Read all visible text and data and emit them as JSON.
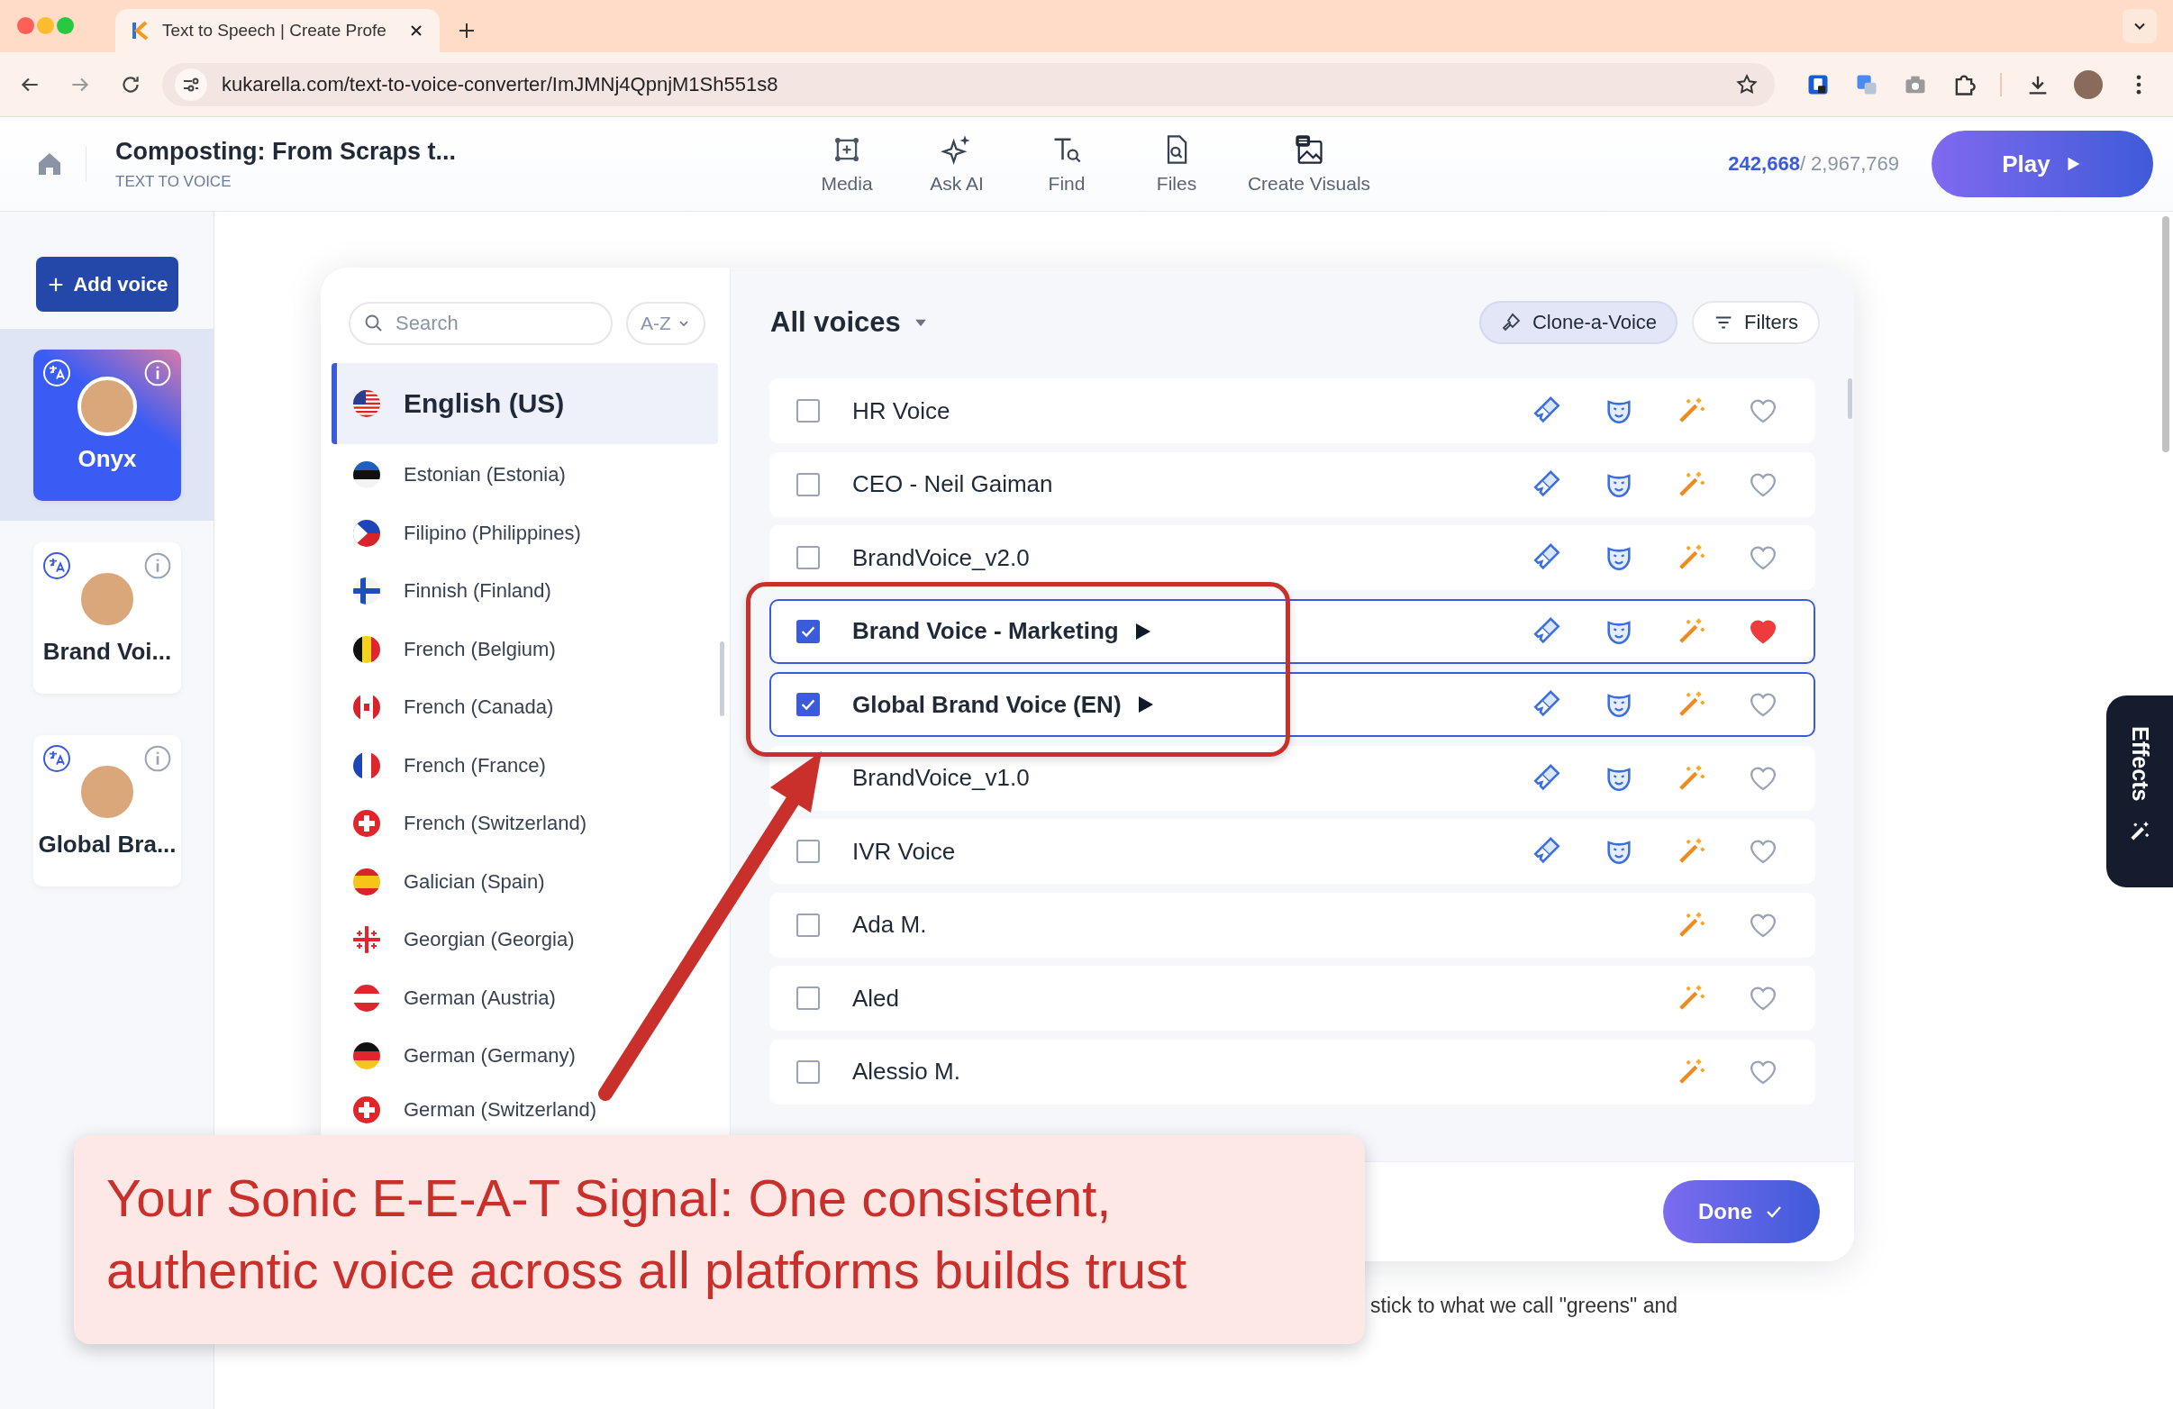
{
  "browser": {
    "tab_title": "Text to Speech | Create Profe",
    "url": "kukarella.com/text-to-voice-converter/ImJMNj4QpnjM1Sh551s8"
  },
  "header": {
    "title": "Composting: From Scraps t...",
    "subtitle": "TEXT TO VOICE",
    "tools": [
      {
        "label": "Media",
        "kind": "media"
      },
      {
        "label": "Ask AI",
        "kind": "ai"
      },
      {
        "label": "Find",
        "kind": "find"
      },
      {
        "label": "Files",
        "kind": "files"
      },
      {
        "label": "Create Visuals",
        "kind": "visuals"
      }
    ],
    "count_used": "242,668",
    "count_total": "/ 2,967,769",
    "play": "Play"
  },
  "sidebar": {
    "add_voice": "Add voice",
    "voices": [
      {
        "name": "Onyx",
        "selected": true
      },
      {
        "name": "Brand Voi...",
        "selected": false
      },
      {
        "name": "Global Bra...",
        "selected": false
      }
    ]
  },
  "panel": {
    "search": {
      "placeholder": "Search"
    },
    "sort": "A-Z",
    "languages": [
      {
        "name": "English (US)",
        "kind": "us",
        "selected": true
      },
      {
        "name": "Estonian (Estonia)",
        "kind": "ee",
        "selected": false
      },
      {
        "name": "Filipino (Philippines)",
        "kind": "ph",
        "selected": false
      },
      {
        "name": "Finnish (Finland)",
        "kind": "fi",
        "selected": false
      },
      {
        "name": "French (Belgium)",
        "kind": "be",
        "selected": false
      },
      {
        "name": "French (Canada)",
        "kind": "ca",
        "selected": false
      },
      {
        "name": "French (France)",
        "kind": "fr",
        "selected": false
      },
      {
        "name": "French (Switzerland)",
        "kind": "ch",
        "selected": false
      },
      {
        "name": "Galician (Spain)",
        "kind": "es",
        "selected": false
      },
      {
        "name": "Georgian (Georgia)",
        "kind": "ge",
        "selected": false
      },
      {
        "name": "German (Austria)",
        "kind": "at",
        "selected": false
      },
      {
        "name": "German (Germany)",
        "kind": "de",
        "selected": false
      },
      {
        "name": "German (Switzerland)",
        "kind": "ch",
        "selected": false
      }
    ],
    "title": "All voices",
    "clone": "Clone-a-Voice",
    "filters": "Filters",
    "voices": [
      {
        "name": "HR Voice",
        "kind": "cloned",
        "checked": false,
        "favorite": false,
        "preview": false
      },
      {
        "name": "CEO - Neil Gaiman",
        "kind": "cloned",
        "checked": false,
        "favorite": false,
        "preview": false
      },
      {
        "name": "BrandVoice_v2.0",
        "kind": "cloned",
        "checked": false,
        "favorite": false,
        "preview": false
      },
      {
        "name": "Brand Voice - Marketing",
        "kind": "cloned",
        "checked": true,
        "favorite": true,
        "preview": true
      },
      {
        "name": "Global Brand Voice (EN)",
        "kind": "cloned",
        "checked": true,
        "favorite": false,
        "preview": true
      },
      {
        "name": "BrandVoice_v1.0",
        "kind": "cloned",
        "favorite": false,
        "preview": false
      },
      {
        "name": "IVR Voice",
        "kind": "cloned",
        "checked": false,
        "favorite": false,
        "preview": false
      },
      {
        "name": "Ada M.",
        "kind": "standard",
        "checked": false,
        "favorite": false,
        "preview": false
      },
      {
        "name": "Aled",
        "kind": "standard",
        "checked": false,
        "favorite": false,
        "preview": false
      },
      {
        "name": "Alessio M.",
        "kind": "standard",
        "checked": false,
        "favorite": false,
        "preview": false
      }
    ],
    "done": "Done"
  },
  "document": {
    "text_fragment": "stick to what we call \"greens\" and"
  },
  "effects": {
    "label": "Effects"
  },
  "callout": {
    "text": "Your Sonic E-E-A-T Signal: One consistent,\nauthentic voice across all platforms builds trust"
  }
}
